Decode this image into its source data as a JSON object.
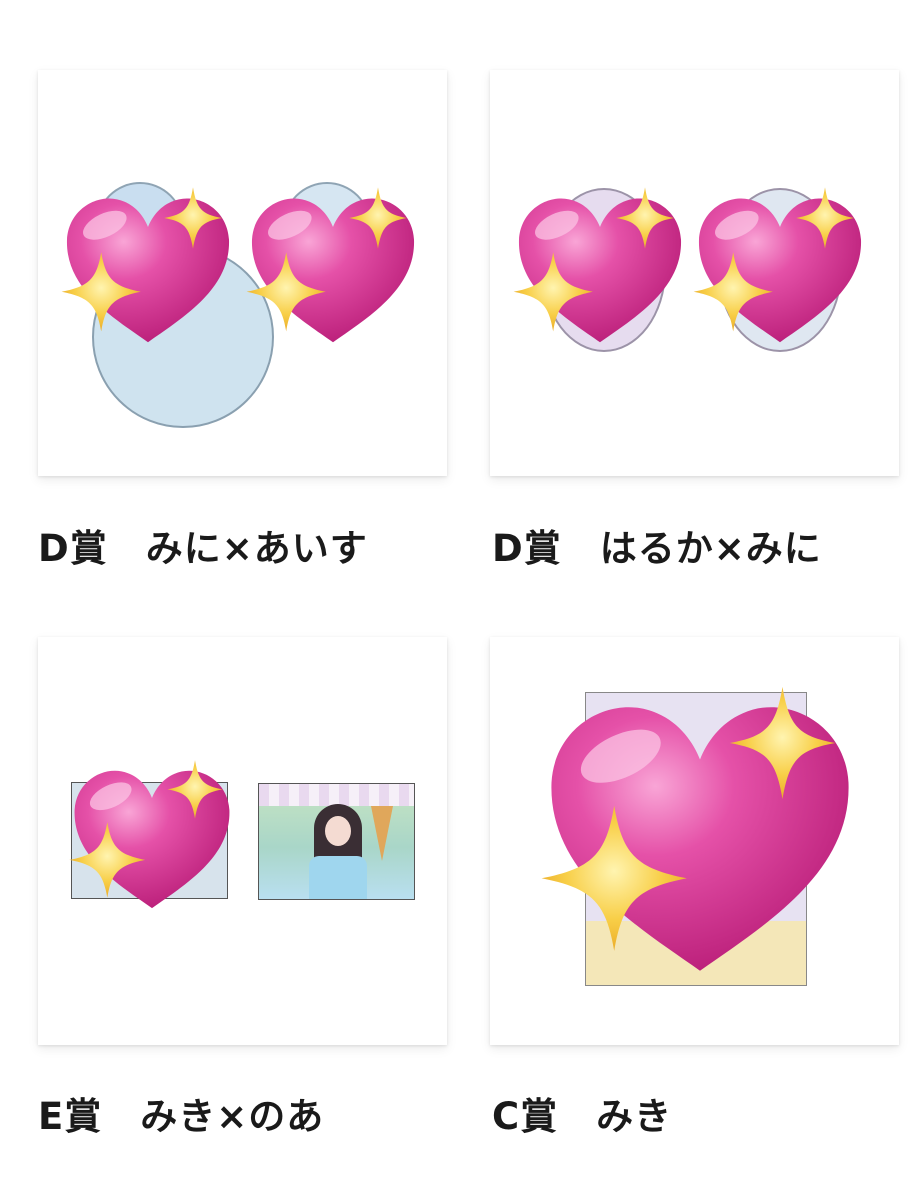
{
  "items": [
    {
      "caption": "D賞　みに×あいす",
      "item_type": "two-round-badges"
    },
    {
      "caption": "D賞　はるか×みに",
      "item_type": "two-round-badges"
    },
    {
      "caption": "E賞　みき×のあ",
      "item_type": "two-photo-cards"
    },
    {
      "caption": "C賞　みき",
      "item_type": "acrylic-stand"
    }
  ],
  "overlay_icon": "sparkling-heart-icon",
  "colors": {
    "heart_main": "#e0439c",
    "heart_light": "#f58ac8",
    "heart_dark": "#b8207a",
    "sparkle": "#f6c940",
    "sparkle_light": "#fde68a",
    "caption_text": "#1a1a1a",
    "card_bg": "#ffffff"
  }
}
